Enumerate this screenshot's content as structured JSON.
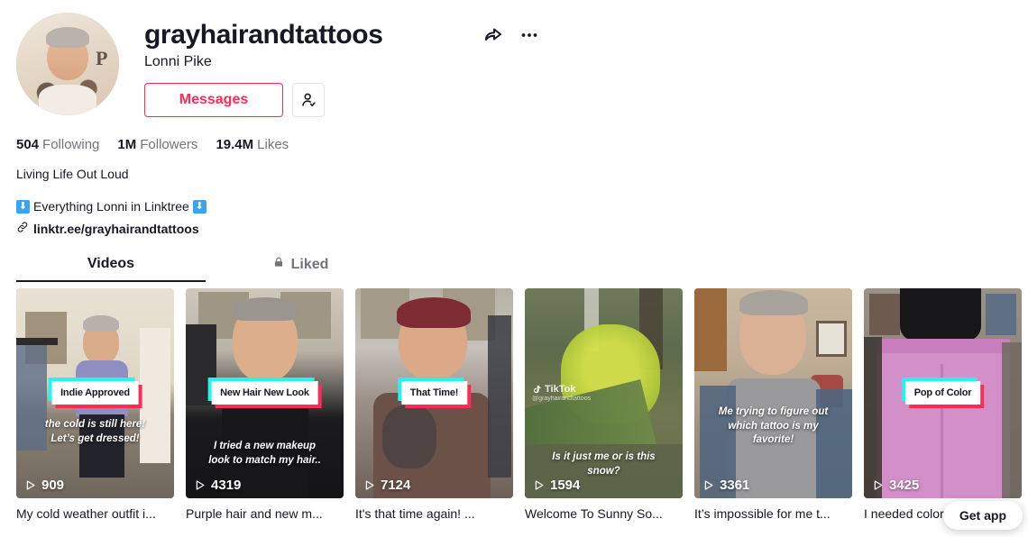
{
  "profile": {
    "username": "grayhairandtattoos",
    "nickname": "Lonni Pike",
    "avatar_letter": "P",
    "messages_label": "Messages",
    "share_icon": "share-icon",
    "more_icon": "more-options-icon",
    "add_user_icon": "add-user-icon"
  },
  "stats": {
    "following_count": "504",
    "following_label": "Following",
    "followers_count": "1M",
    "followers_label": "Followers",
    "likes_count": "19.4M",
    "likes_label": "Likes"
  },
  "bio": {
    "line1": "Living Life Out Loud",
    "line2": "Everything Lonni in Linktree",
    "emoji": "⬇",
    "link": "linktr.ee/grayhairandtattoos"
  },
  "tabs": {
    "videos_label": "Videos",
    "liked_label": "Liked",
    "lock_icon": "lock-icon",
    "active": "Videos"
  },
  "videos": [
    {
      "overlay_box": "Indie Approved",
      "overlay_text": "the cold is still here!\nLet’s get dressed!",
      "plays": "909",
      "caption": "My cold weather outfit i..."
    },
    {
      "overlay_box": "New Hair New Look",
      "overlay_text": "I tried a new makeup\nlook to match my hair..",
      "plays": "4319",
      "caption": "Purple hair and new m..."
    },
    {
      "overlay_box": "That Time!",
      "overlay_text": "",
      "plays": "7124",
      "caption": "It's that time again! ..."
    },
    {
      "overlay_box": "",
      "overlay_text": "Is it just me or is this\nsnow?",
      "plays": "1594",
      "caption": "Welcome To Sunny So...",
      "watermark": "TikTok",
      "watermark_sub": "@grayhairandtattoos"
    },
    {
      "overlay_box": "",
      "overlay_text": "Me trying to figure out\nwhich tattoo is my\nfavorite!",
      "plays": "3361",
      "caption": "It’s impossible for me t..."
    },
    {
      "overlay_box": "Pop of Color",
      "overlay_text": "",
      "plays": "3425",
      "caption": "I needed color"
    }
  ],
  "get_app": {
    "label": "Get app"
  },
  "colors": {
    "accent_red": "#fe2c55",
    "accent_cyan": "#25f4ee",
    "text_primary": "#161823",
    "text_secondary": "#73747b",
    "link_blue": "#3ba4f2"
  }
}
